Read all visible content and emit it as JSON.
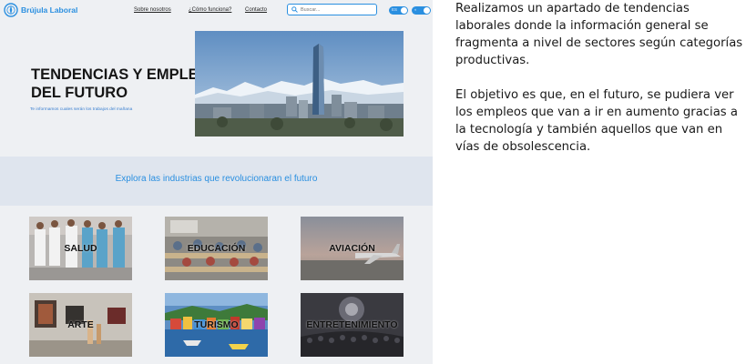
{
  "site": {
    "logo_text": "Brújula Laboral",
    "nav": [
      "Sobre nosotros",
      "¿Cómo funciona?",
      "Contacto"
    ],
    "search_placeholder": "Buscar...",
    "toggles": [
      {
        "label": "ES"
      },
      {
        "label": "◐"
      }
    ],
    "hero": {
      "title": "TENDENCIAS Y EMPLEOS DEL FUTURO",
      "subtitle": "Te informamos cuales serán los trabajos del mañana"
    },
    "band_text": "Explora las industrias que revolucionaran el futuro",
    "cards": [
      {
        "label": "SALUD"
      },
      {
        "label": "EDUCACIÓN"
      },
      {
        "label": "AVIACIÓN"
      },
      {
        "label": "ARTE"
      },
      {
        "label": "TURISMO"
      },
      {
        "label": "ENTRETENIMIENTO"
      }
    ]
  },
  "description": {
    "paragraph1": "Realizamos un apartado de tendencias laborales donde la información general se fragmenta  a nivel de sectores según categorías productivas.",
    "paragraph2": "El objetivo es que, en el futuro,  se pudiera ver los empleos que van a ir en aumento gracias a la tecnología y también aquellos que van en vías de obsolescencia."
  },
  "colors": {
    "accent": "#2a8fe0",
    "page_bg": "#eef0f3",
    "band_bg": "#dfe5ee"
  }
}
